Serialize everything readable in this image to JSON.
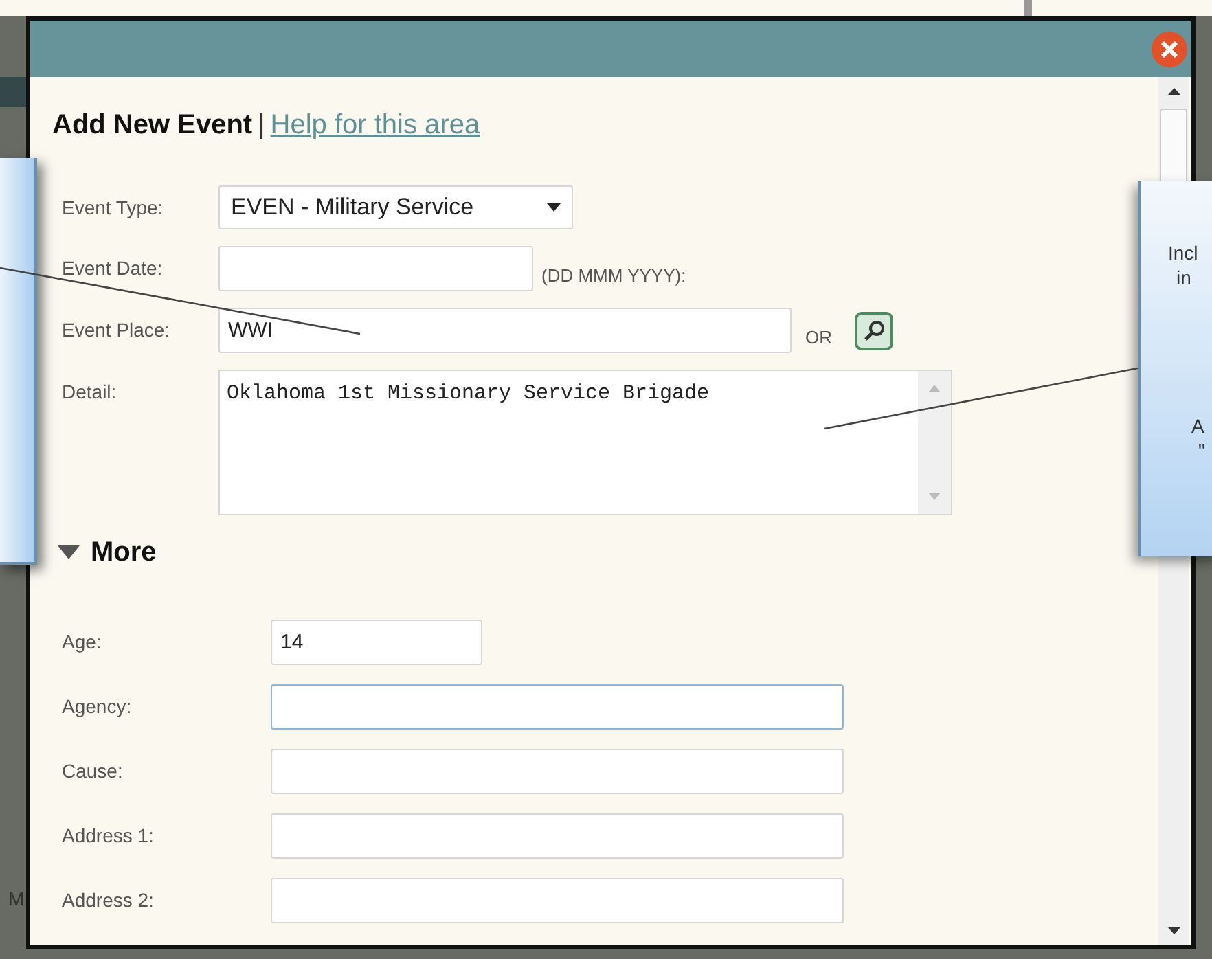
{
  "dialog": {
    "title": "Add New Event",
    "separator": "|",
    "help_link": "Help for this area",
    "fields": [
      {
        "kind": "select",
        "label": "Event Type:",
        "value": "EVEN - Military Service"
      },
      {
        "kind": "text",
        "label": "Event Date:",
        "hint": "(DD MMM YYYY):"
      },
      {
        "kind": "text",
        "label": "Event Place:",
        "value": "WWI",
        "or_text": "OR",
        "lookup": true
      },
      {
        "kind": "textarea",
        "label": "Detail:",
        "value": "Oklahoma 1st Missionary Service Brigade"
      }
    ],
    "more": {
      "label": "More",
      "expanded": true,
      "fields": [
        {
          "label": "Age:",
          "value": "14",
          "focused": false,
          "kind": "short"
        },
        {
          "label": "Agency:",
          "focused": true,
          "kind": "long"
        },
        {
          "label": "Cause:",
          "focused": false,
          "kind": "long"
        },
        {
          "label": "Address 1:",
          "focused": false,
          "kind": "long"
        },
        {
          "label": "Address 2:",
          "focused": false,
          "kind": "long"
        }
      ]
    }
  },
  "callouts": [
    {
      "kind": "left"
    },
    {
      "kind": "right",
      "lines": [
        "Incl",
        "in",
        "A",
        "\""
      ]
    }
  ],
  "background": {
    "text": "M"
  }
}
